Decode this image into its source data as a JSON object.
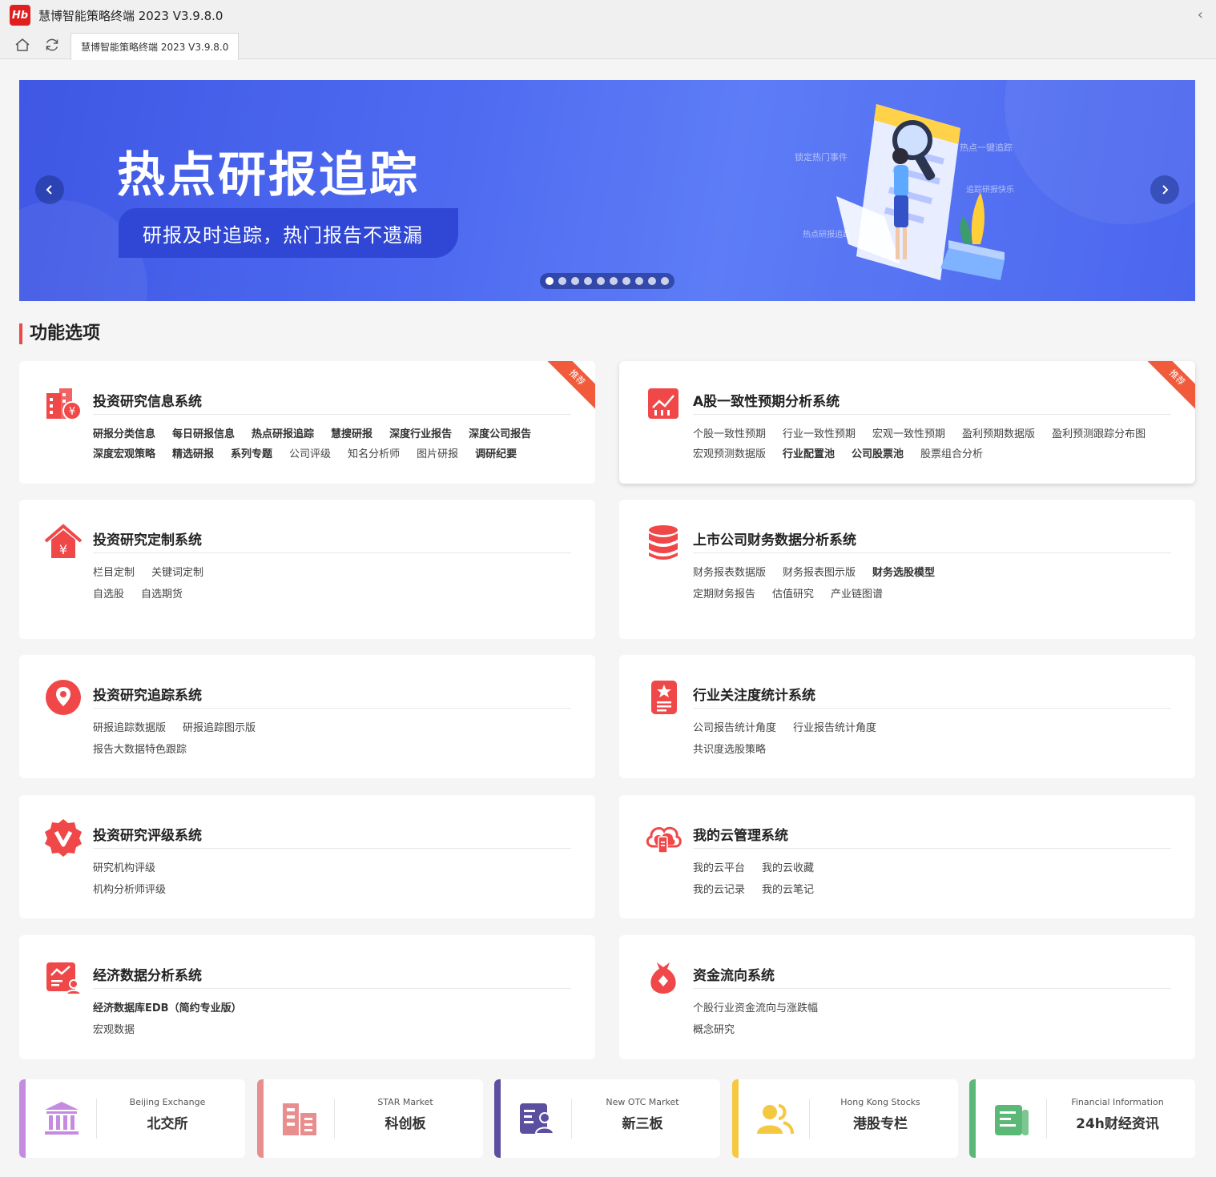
{
  "window": {
    "logo_text": "Hb",
    "title": "慧博智能策略终端 2023 V3.9.8.0",
    "collapse_glyph": "‹"
  },
  "tabs": [
    {
      "label": "慧博智能策略终端 2023 V3.9.8.0"
    }
  ],
  "banner": {
    "title": "热点研报追踪",
    "subtitle": "研报及时追踪，热门报告不遗漏",
    "hand_labels": [
      "锁定热门事件",
      "热点一键追踪",
      "追踪研报快乐",
      "热点研报追踪"
    ],
    "slide_count": 10,
    "active_slide": 1
  },
  "section": {
    "title": "功能选项"
  },
  "cards": [
    {
      "title": "投资研究信息系统",
      "badge": "推荐",
      "icon": "building-yen-icon",
      "rows": [
        [
          {
            "t": "研报分类信息",
            "b": true
          },
          {
            "t": "每日研报信息",
            "b": true
          },
          {
            "t": "热点研报追踪",
            "b": true
          },
          {
            "t": "慧搜研报",
            "b": true
          },
          {
            "t": "深度行业报告",
            "b": true
          },
          {
            "t": "深度公司报告",
            "b": true
          }
        ],
        [
          {
            "t": "深度宏观策略",
            "b": true
          },
          {
            "t": "精选研报",
            "b": true
          },
          {
            "t": "系列专题",
            "b": true
          },
          {
            "t": "公司评级",
            "b": false
          },
          {
            "t": "知名分析师",
            "b": false
          },
          {
            "t": "图片研报",
            "b": false
          },
          {
            "t": "调研纪要",
            "b": true
          }
        ]
      ]
    },
    {
      "title": "A股一致性预期分析系统",
      "badge": "推荐",
      "icon": "chart-doc-icon",
      "rows": [
        [
          {
            "t": "个股一致性预期",
            "b": false
          },
          {
            "t": "行业一致性预期",
            "b": false
          },
          {
            "t": "宏观一致性预期",
            "b": false
          },
          {
            "t": "盈利预期数据版",
            "b": false
          },
          {
            "t": "盈利预测跟踪分布图",
            "b": false
          }
        ],
        [
          {
            "t": "宏观预测数据版",
            "b": false
          },
          {
            "t": "行业配置池",
            "b": true
          },
          {
            "t": "公司股票池",
            "b": true
          },
          {
            "t": "股票组合分析",
            "b": false
          }
        ]
      ]
    },
    {
      "title": "投资研究定制系统",
      "badge": "",
      "icon": "house-yen-icon",
      "rows": [
        [
          {
            "t": "栏目定制",
            "b": false
          },
          {
            "t": "关键词定制",
            "b": false
          }
        ],
        [
          {
            "t": "自选股",
            "b": false
          },
          {
            "t": "自选期货",
            "b": false
          }
        ]
      ]
    },
    {
      "title": "上市公司财务数据分析系统",
      "badge": "",
      "icon": "database-icon",
      "rows": [
        [
          {
            "t": "财务报表数据版",
            "b": false
          },
          {
            "t": "财务报表图示版",
            "b": false
          },
          {
            "t": "财务选股模型",
            "b": true
          }
        ],
        [
          {
            "t": "定期财务报告",
            "b": false
          },
          {
            "t": "估值研究",
            "b": false
          },
          {
            "t": "产业链图谱",
            "b": false
          }
        ]
      ]
    },
    {
      "title": "投资研究追踪系统",
      "badge": "",
      "icon": "location-pin-icon",
      "rows": [
        [
          {
            "t": "研报追踪数据版",
            "b": false
          },
          {
            "t": "研报追踪图示版",
            "b": false
          }
        ],
        [
          {
            "t": "报告大数据特色跟踪",
            "b": false
          }
        ]
      ]
    },
    {
      "title": "行业关注度统计系统",
      "badge": "",
      "icon": "star-document-icon",
      "rows": [
        [
          {
            "t": "公司报告统计角度",
            "b": false
          },
          {
            "t": "行业报告统计角度",
            "b": false
          }
        ],
        [
          {
            "t": "共识度选股策略",
            "b": false
          }
        ]
      ]
    },
    {
      "title": "投资研究评级系统",
      "badge": "",
      "icon": "v-badge-icon",
      "rows": [
        [
          {
            "t": "研究机构评级",
            "b": false
          }
        ],
        [
          {
            "t": "机构分析师评级",
            "b": false
          }
        ]
      ]
    },
    {
      "title": "我的云管理系统",
      "badge": "",
      "icon": "cloud-phone-icon",
      "rows": [
        [
          {
            "t": "我的云平台",
            "b": false
          },
          {
            "t": "我的云收藏",
            "b": false
          }
        ],
        [
          {
            "t": "我的云记录",
            "b": false
          },
          {
            "t": "我的云笔记",
            "b": false
          }
        ]
      ]
    },
    {
      "title": "经济数据分析系统",
      "badge": "",
      "icon": "chart-user-icon",
      "rows": [
        [
          {
            "t": "经济数据库EDB（简约专业版）",
            "b": true
          }
        ],
        [
          {
            "t": "宏观数据",
            "b": false
          }
        ]
      ]
    },
    {
      "title": "资金流向系统",
      "badge": "",
      "icon": "money-bag-icon",
      "rows": [
        [
          {
            "t": "个股行业资金流向与涨跌幅",
            "b": false
          }
        ],
        [
          {
            "t": "概念研究",
            "b": false
          }
        ]
      ]
    }
  ],
  "quick_links": [
    {
      "en": "Beijing Exchange",
      "cn": "北交所",
      "color": "#c58be0",
      "icon": "bank-building-icon"
    },
    {
      "en": "STAR Market",
      "cn": "科创板",
      "color": "#e98e8e",
      "icon": "office-buildings-icon"
    },
    {
      "en": "New OTC Market",
      "cn": "新三板",
      "color": "#5b4fa0",
      "icon": "doc-person-icon"
    },
    {
      "en": "Hong Kong Stocks",
      "cn": "港股专栏",
      "color": "#f5c842",
      "icon": "users-icon"
    },
    {
      "en": "Financial Information",
      "cn": "24h财经资讯",
      "color": "#5cb877",
      "icon": "news-doc-icon"
    }
  ]
}
